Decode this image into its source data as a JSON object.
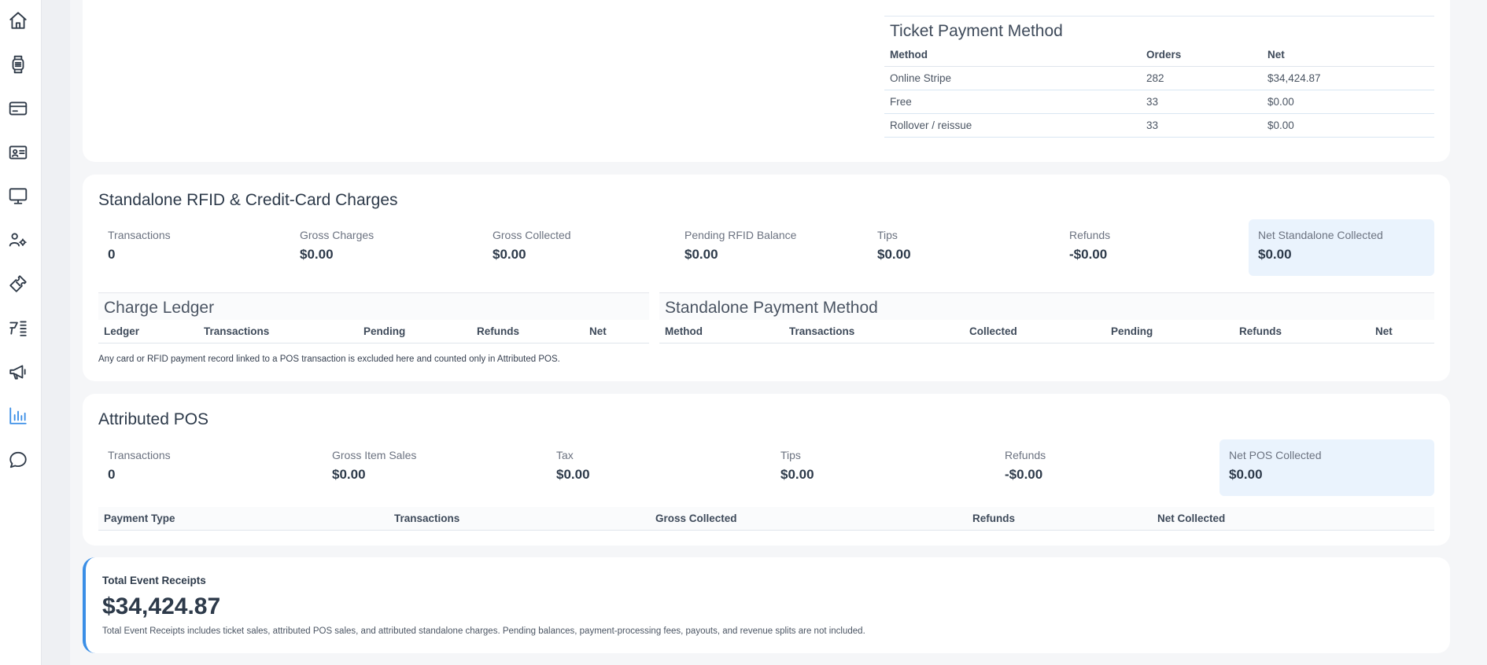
{
  "sidebar": {
    "items": [
      {
        "icon": "home-icon"
      },
      {
        "icon": "wristband-icon"
      },
      {
        "icon": "credit-card-icon"
      },
      {
        "icon": "id-card-icon"
      },
      {
        "icon": "monitor-icon"
      },
      {
        "icon": "users-settings-icon"
      },
      {
        "icon": "ticket-icon"
      },
      {
        "icon": "menu-list-icon"
      },
      {
        "icon": "megaphone-icon"
      },
      {
        "icon": "bar-chart-icon",
        "active": true
      },
      {
        "icon": "chat-icon"
      }
    ],
    "accent_color": "#3a8ee6"
  },
  "ticket_payment_method": {
    "title": "Ticket Payment Method",
    "columns": [
      "Method",
      "Orders",
      "Net"
    ],
    "rows": [
      [
        "Online Stripe",
        "282",
        "$34,424.87"
      ],
      [
        "Free",
        "33",
        "$0.00"
      ],
      [
        "Rollover / reissue",
        "33",
        "$0.00"
      ]
    ]
  },
  "standalone": {
    "title": "Standalone RFID & Credit-Card Charges",
    "metrics": [
      {
        "label": "Transactions",
        "value": "0"
      },
      {
        "label": "Gross Charges",
        "value": "$0.00"
      },
      {
        "label": "Gross Collected",
        "value": "$0.00"
      },
      {
        "label": "Pending RFID Balance",
        "value": "$0.00"
      },
      {
        "label": "Tips",
        "value": "$0.00"
      },
      {
        "label": "Refunds",
        "value": "-$0.00"
      },
      {
        "label": "Net Standalone Collected",
        "value": "$0.00"
      }
    ],
    "charge_ledger": {
      "title": "Charge Ledger",
      "columns": [
        "Ledger",
        "Transactions",
        "Pending",
        "Refunds",
        "Net"
      ]
    },
    "payment_method": {
      "title": "Standalone Payment Method",
      "columns": [
        "Method",
        "Transactions",
        "Collected",
        "Pending",
        "Refunds",
        "Net"
      ]
    },
    "note": "Any card or RFID payment record linked to a POS transaction is excluded here and counted only in Attributed POS."
  },
  "pos": {
    "title": "Attributed POS",
    "metrics": [
      {
        "label": "Transactions",
        "value": "0"
      },
      {
        "label": "Gross Item Sales",
        "value": "$0.00"
      },
      {
        "label": "Tax",
        "value": "$0.00"
      },
      {
        "label": "Tips",
        "value": "$0.00"
      },
      {
        "label": "Refunds",
        "value": "-$0.00"
      },
      {
        "label": "Net POS Collected",
        "value": "$0.00"
      }
    ],
    "columns": [
      "Payment Type",
      "Transactions",
      "Gross Collected",
      "Refunds",
      "Net Collected"
    ]
  },
  "total": {
    "label": "Total Event Receipts",
    "value": "$34,424.87",
    "note": "Total Event Receipts includes ticket sales, attributed POS sales, and attributed standalone charges. Pending balances, payment-processing fees, payouts, and revenue splits are not included."
  }
}
